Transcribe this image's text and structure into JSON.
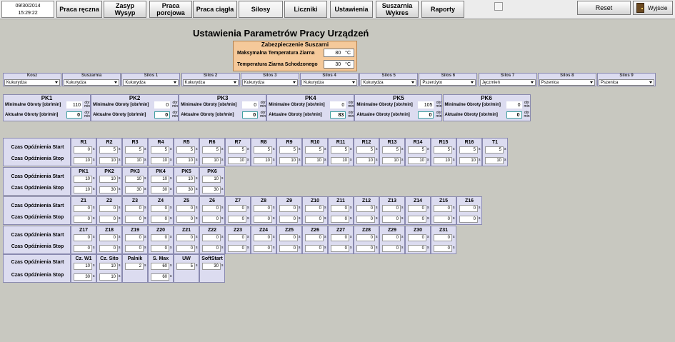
{
  "top": {
    "date": "09/30/2014",
    "time": "15:29:22",
    "reset": "Reset",
    "exit": "Wyjście",
    "nav": [
      "Praca ręczna",
      "Zasyp\nWysyp",
      "Praca\nporcjowa",
      "Praca ciągła",
      "Silosy",
      "Liczniki",
      "Ustawienia",
      "Suszarnia\nWykres",
      "Raporty"
    ]
  },
  "page": {
    "title": "Ustawienia Parametrów Pracy Urządzeń"
  },
  "safety": {
    "title": "Zabezpieczenie Suszarni",
    "max_label": "Maksymalna Temperatura Ziarna",
    "max_val": "80",
    "cool_label": "Temperatura Ziarna Schodzonego",
    "cool_val": "30",
    "unit": "°C"
  },
  "selectors": [
    {
      "label": "Kosz",
      "value": "Kukurydza"
    },
    {
      "label": "Suszarnia",
      "value": "Kukurydza"
    },
    {
      "label": "Silos 1",
      "value": "Kukurydza"
    },
    {
      "label": "Silos 2",
      "value": "Kukurydza"
    },
    {
      "label": "Silos 3",
      "value": "Kukurydza"
    },
    {
      "label": "Silos 4",
      "value": "Kukurydza"
    },
    {
      "label": "Silos 5",
      "value": "Kukurydza"
    },
    {
      "label": "Silos 6",
      "value": "Pszenżyto"
    },
    {
      "label": "Silos 7",
      "value": "Jęczmień"
    },
    {
      "label": "Silos 8",
      "value": "Pszenica"
    },
    {
      "label": "Silos 9",
      "value": "Pszenica"
    }
  ],
  "pk": {
    "min_label": "Minimalne Obroty [obr/min]",
    "act_label": "Aktualne Obroty [obr/min]",
    "unit_top": "obr",
    "unit_bot": "min",
    "items": [
      {
        "name": "PK1",
        "min": "110",
        "act": "0"
      },
      {
        "name": "PK2",
        "min": "0",
        "act": "0"
      },
      {
        "name": "PK3",
        "min": "0",
        "act": "0"
      },
      {
        "name": "PK4",
        "min": "0",
        "act": "83"
      },
      {
        "name": "PK5",
        "min": "105",
        "act": "0"
      },
      {
        "name": "PK6",
        "min": "0",
        "act": "0"
      }
    ]
  },
  "delay": {
    "start_label": "Czas Opóźnienia Start",
    "stop_label": "Czas Opóźnienia Stop",
    "unit": "s",
    "groups": [
      {
        "cells": [
          {
            "n": "R1",
            "s": "0",
            "t": "10"
          },
          {
            "n": "R2",
            "s": "5",
            "t": "10"
          },
          {
            "n": "R3",
            "s": "5",
            "t": "10"
          },
          {
            "n": "R4",
            "s": "5",
            "t": "10"
          },
          {
            "n": "R5",
            "s": "5",
            "t": "10"
          },
          {
            "n": "R6",
            "s": "5",
            "t": "10"
          },
          {
            "n": "R7",
            "s": "5",
            "t": "10"
          },
          {
            "n": "R8",
            "s": "5",
            "t": "10"
          },
          {
            "n": "R9",
            "s": "5",
            "t": "10"
          },
          {
            "n": "R10",
            "s": "5",
            "t": "10"
          },
          {
            "n": "R11",
            "s": "5",
            "t": "10"
          },
          {
            "n": "R12",
            "s": "5",
            "t": "10"
          },
          {
            "n": "R13",
            "s": "5",
            "t": "10"
          },
          {
            "n": "R14",
            "s": "5",
            "t": "10"
          },
          {
            "n": "R15",
            "s": "5",
            "t": "10"
          },
          {
            "n": "R16",
            "s": "5",
            "t": "10"
          },
          {
            "n": "T1",
            "s": "5",
            "t": "10"
          }
        ]
      },
      {
        "cells": [
          {
            "n": "PK1",
            "s": "10",
            "t": "10"
          },
          {
            "n": "PK2",
            "s": "10",
            "t": "30"
          },
          {
            "n": "PK3",
            "s": "10",
            "t": "30"
          },
          {
            "n": "PK4",
            "s": "10",
            "t": "30"
          },
          {
            "n": "PK5",
            "s": "10",
            "t": "30"
          },
          {
            "n": "PK6",
            "s": "10",
            "t": "30"
          }
        ]
      },
      {
        "cells": [
          {
            "n": "Z1",
            "s": "0",
            "t": "0"
          },
          {
            "n": "Z2",
            "s": "0",
            "t": "0"
          },
          {
            "n": "Z3",
            "s": "0",
            "t": "0"
          },
          {
            "n": "Z4",
            "s": "0",
            "t": "0"
          },
          {
            "n": "Z5",
            "s": "0",
            "t": "0"
          },
          {
            "n": "Z6",
            "s": "0",
            "t": "0"
          },
          {
            "n": "Z7",
            "s": "0",
            "t": "0"
          },
          {
            "n": "Z8",
            "s": "0",
            "t": "0"
          },
          {
            "n": "Z9",
            "s": "0",
            "t": "0"
          },
          {
            "n": "Z10",
            "s": "0",
            "t": "0"
          },
          {
            "n": "Z11",
            "s": "0",
            "t": "0"
          },
          {
            "n": "Z12",
            "s": "0",
            "t": "0"
          },
          {
            "n": "Z13",
            "s": "0",
            "t": "0"
          },
          {
            "n": "Z14",
            "s": "0",
            "t": "0"
          },
          {
            "n": "Z15",
            "s": "0",
            "t": "0"
          },
          {
            "n": "Z16",
            "s": "0",
            "t": "0"
          }
        ]
      },
      {
        "cells": [
          {
            "n": "Z17",
            "s": "0",
            "t": "0"
          },
          {
            "n": "Z18",
            "s": "0",
            "t": "0"
          },
          {
            "n": "Z19",
            "s": "0",
            "t": "0"
          },
          {
            "n": "Z20",
            "s": "0",
            "t": "0"
          },
          {
            "n": "Z21",
            "s": "0",
            "t": "0"
          },
          {
            "n": "Z22",
            "s": "0",
            "t": "0"
          },
          {
            "n": "Z23",
            "s": "0",
            "t": "0"
          },
          {
            "n": "Z24",
            "s": "0",
            "t": "0"
          },
          {
            "n": "Z25",
            "s": "0",
            "t": "0"
          },
          {
            "n": "Z26",
            "s": "0",
            "t": "0"
          },
          {
            "n": "Z27",
            "s": "0",
            "t": "0"
          },
          {
            "n": "Z28",
            "s": "0",
            "t": "0"
          },
          {
            "n": "Z29",
            "s": "0",
            "t": "0"
          },
          {
            "n": "Z30",
            "s": "0",
            "t": "0"
          },
          {
            "n": "Z31",
            "s": "0",
            "t": "0"
          }
        ]
      },
      {
        "cells": [
          {
            "n": "Cz. W1",
            "s": "10",
            "t": "30"
          },
          {
            "n": "Cz. Sito",
            "s": "10",
            "t": "10"
          },
          {
            "n": "Palnik",
            "s": "2",
            "t": null
          },
          {
            "n": "S. Max",
            "s": "60",
            "t": "60"
          },
          {
            "n": "UW",
            "s": "5",
            "t": null
          },
          {
            "n": "SoftStart",
            "s": "30",
            "t": null
          }
        ]
      }
    ]
  }
}
